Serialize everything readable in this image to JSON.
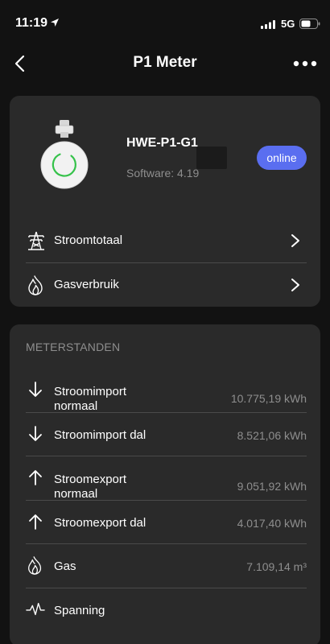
{
  "status_bar": {
    "time": "11:19",
    "network": "5G"
  },
  "nav": {
    "title": "P1 Meter"
  },
  "device": {
    "name": "HWE-P1-G1",
    "software": "Software: 4.19",
    "status": "online",
    "status_color": "#5a6ef0"
  },
  "links": [
    {
      "label": "Stroomtotaal",
      "icon": "power-pylon-icon"
    },
    {
      "label": "Gasverbruik",
      "icon": "gas-flame-icon"
    }
  ],
  "meters": {
    "header": "METERSTANDEN",
    "rows": [
      {
        "label_line1": "Stroomimport",
        "label_line2": "normaal",
        "value": "10.775,19 kWh",
        "icon": "arrow-down-icon"
      },
      {
        "label_line1": "Stroomimport dal",
        "label_line2": "",
        "value": "8.521,06 kWh",
        "icon": "arrow-down-icon"
      },
      {
        "label_line1": "Stroomexport",
        "label_line2": "normaal",
        "value": "9.051,92 kWh",
        "icon": "arrow-up-icon"
      },
      {
        "label_line1": "Stroomexport dal",
        "label_line2": "",
        "value": "4.017,40 kWh",
        "icon": "arrow-up-icon"
      },
      {
        "label_line1": "Gas",
        "label_line2": "",
        "value": "7.109,14 m³",
        "icon": "gas-flame-icon"
      },
      {
        "label_line1": "Spanning",
        "label_line2": "",
        "value": "",
        "icon": "voltage-wave-icon"
      }
    ]
  }
}
